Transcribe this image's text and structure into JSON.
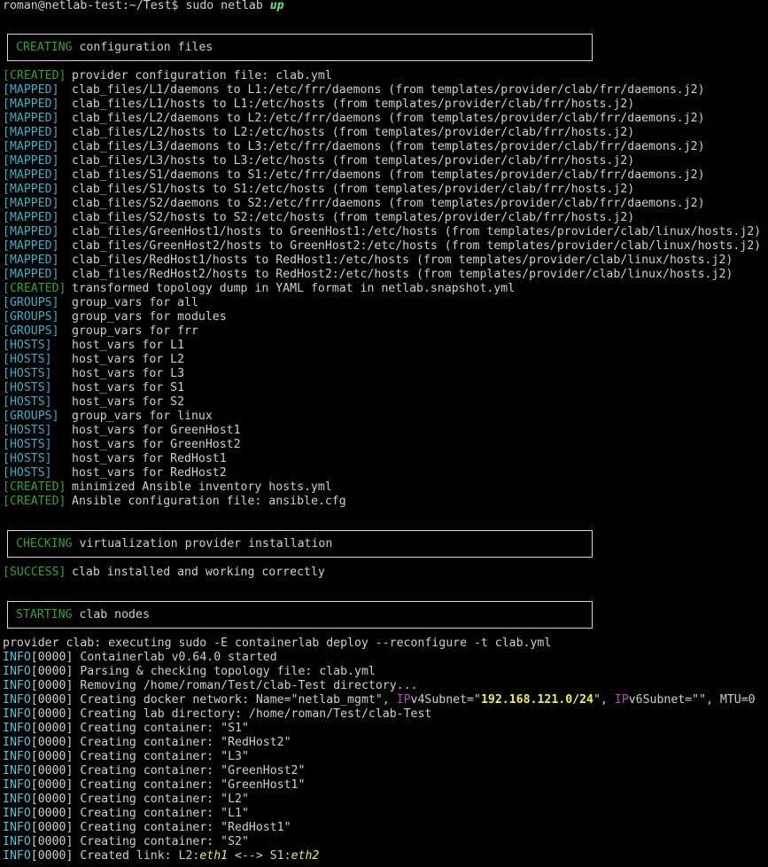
{
  "prompt": {
    "user_host": "roman@netlab-test",
    "path": ":~/Test$",
    "command": "sudo netlab",
    "arg": "up"
  },
  "sections": {
    "creating": {
      "status": "CREATING",
      "text": "configuration files"
    },
    "checking": {
      "status": "CHECKING",
      "text": "virtualization provider installation"
    },
    "starting": {
      "status": "STARTING",
      "text": "clab nodes"
    }
  },
  "creating_lines": [
    {
      "status": "[CREATED]",
      "text": "provider configuration file: clab.yml"
    },
    {
      "status": "[MAPPED]",
      "text": "clab_files/L1/daemons to L1:/etc/frr/daemons (from templates/provider/clab/frr/daemons.j2)"
    },
    {
      "status": "[MAPPED]",
      "text": "clab_files/L1/hosts to L1:/etc/hosts (from templates/provider/clab/frr/hosts.j2)"
    },
    {
      "status": "[MAPPED]",
      "text": "clab_files/L2/daemons to L2:/etc/frr/daemons (from templates/provider/clab/frr/daemons.j2)"
    },
    {
      "status": "[MAPPED]",
      "text": "clab_files/L2/hosts to L2:/etc/hosts (from templates/provider/clab/frr/hosts.j2)"
    },
    {
      "status": "[MAPPED]",
      "text": "clab_files/L3/daemons to L3:/etc/frr/daemons (from templates/provider/clab/frr/daemons.j2)"
    },
    {
      "status": "[MAPPED]",
      "text": "clab_files/L3/hosts to L3:/etc/hosts (from templates/provider/clab/frr/hosts.j2)"
    },
    {
      "status": "[MAPPED]",
      "text": "clab_files/S1/daemons to S1:/etc/frr/daemons (from templates/provider/clab/frr/daemons.j2)"
    },
    {
      "status": "[MAPPED]",
      "text": "clab_files/S1/hosts to S1:/etc/hosts (from templates/provider/clab/frr/hosts.j2)"
    },
    {
      "status": "[MAPPED]",
      "text": "clab_files/S2/daemons to S2:/etc/frr/daemons (from templates/provider/clab/frr/daemons.j2)"
    },
    {
      "status": "[MAPPED]",
      "text": "clab_files/S2/hosts to S2:/etc/hosts (from templates/provider/clab/frr/hosts.j2)"
    },
    {
      "status": "[MAPPED]",
      "text": "clab_files/GreenHost1/hosts to GreenHost1:/etc/hosts (from templates/provider/clab/linux/hosts.j2)"
    },
    {
      "status": "[MAPPED]",
      "text": "clab_files/GreenHost2/hosts to GreenHost2:/etc/hosts (from templates/provider/clab/linux/hosts.j2)"
    },
    {
      "status": "[MAPPED]",
      "text": "clab_files/RedHost1/hosts to RedHost1:/etc/hosts (from templates/provider/clab/linux/hosts.j2)"
    },
    {
      "status": "[MAPPED]",
      "text": "clab_files/RedHost2/hosts to RedHost2:/etc/hosts (from templates/provider/clab/linux/hosts.j2)"
    },
    {
      "status": "[CREATED]",
      "text": "transformed topology dump in YAML format in netlab.snapshot.yml"
    },
    {
      "status": "[GROUPS]",
      "text": "group_vars for all"
    },
    {
      "status": "[GROUPS]",
      "text": "group_vars for modules"
    },
    {
      "status": "[GROUPS]",
      "text": "group_vars for frr"
    },
    {
      "status": "[HOSTS]",
      "text": "host_vars for L1"
    },
    {
      "status": "[HOSTS]",
      "text": "host_vars for L2"
    },
    {
      "status": "[HOSTS]",
      "text": "host_vars for L3"
    },
    {
      "status": "[HOSTS]",
      "text": "host_vars for S1"
    },
    {
      "status": "[HOSTS]",
      "text": "host_vars for S2"
    },
    {
      "status": "[GROUPS]",
      "text": "group_vars for linux"
    },
    {
      "status": "[HOSTS]",
      "text": "host_vars for GreenHost1"
    },
    {
      "status": "[HOSTS]",
      "text": "host_vars for GreenHost2"
    },
    {
      "status": "[HOSTS]",
      "text": "host_vars for RedHost1"
    },
    {
      "status": "[HOSTS]",
      "text": "host_vars for RedHost2"
    },
    {
      "status": "[CREATED]",
      "text": "minimized Ansible inventory hosts.yml"
    },
    {
      "status": "[CREATED]",
      "text": "Ansible configuration file: ansible.cfg"
    }
  ],
  "success_line": {
    "status": "[SUCCESS]",
    "text": "clab installed and working correctly"
  },
  "provider_line": "provider clab: executing sudo -E containerlab deploy --reconfigure -t clab.yml",
  "info_prefix": "INFO",
  "info_time": "[0000]",
  "info_lines": [
    "Containerlab v0.64.0 started",
    "Parsing & checking topology file: clab.yml",
    "Removing /home/roman/Test/clab-Test directory..."
  ],
  "network_line": {
    "pre": "Creating docker network: Name=\"netlab_mgmt\", ",
    "ip1": "IP",
    "mid1": "v4Subnet=\"",
    "subnet": "192.168.121.0/24",
    "mid2": "\", ",
    "ip2": "IP",
    "post": "v6Subnet=\"\", MTU=0"
  },
  "info_lines2": [
    "Creating lab directory: /home/roman/Test/clab-Test",
    "Creating container: \"S1\"",
    "Creating container: \"RedHost2\"",
    "Creating container: \"L3\"",
    "Creating container: \"GreenHost2\"",
    "Creating container: \"GreenHost1\"",
    "Creating container: \"L2\"",
    "Creating container: \"L1\"",
    "Creating container: \"RedHost1\"",
    "Creating container: \"S2\""
  ],
  "link_line": {
    "pre": "Created link: L2:",
    "eth_a": "eth1",
    "arrow": " <--> S1:",
    "eth_b": "eth2"
  },
  "colors": {
    "background": "#000000",
    "text": "#d0d0d0",
    "created_green": "#2ea52e",
    "mapped_cyan": "#32b4c8",
    "ip_magenta": "#c040c8",
    "subnet_yellow": "#f0f040",
    "up_green": "#5cf05c"
  }
}
